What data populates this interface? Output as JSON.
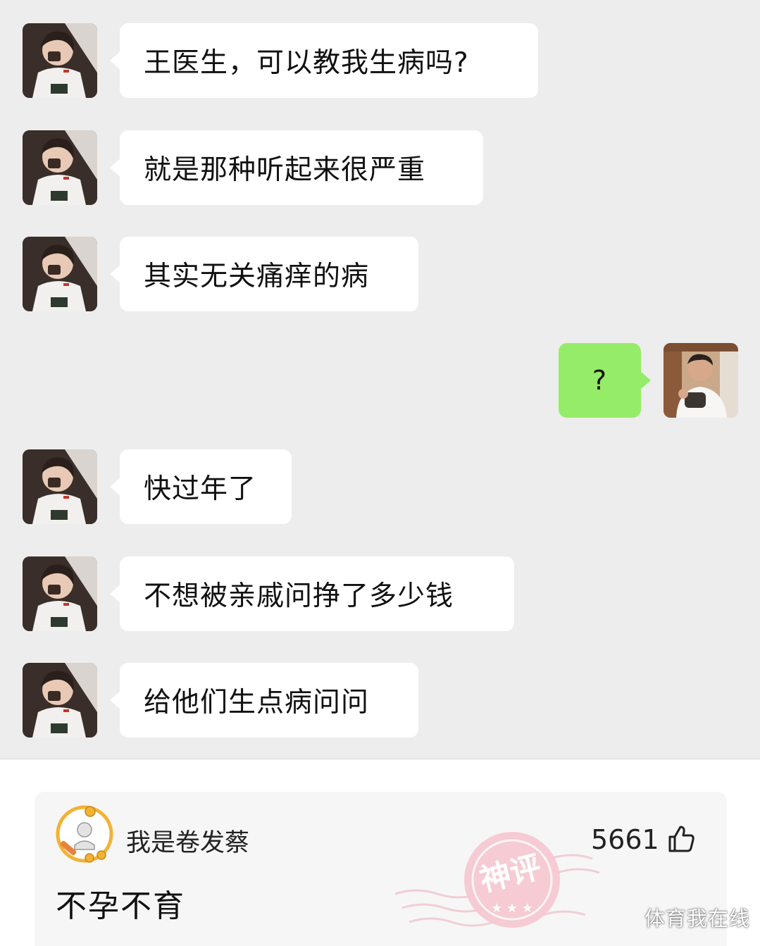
{
  "chat": {
    "messages": [
      {
        "side": "left",
        "text": "王医生，可以教我生病吗?"
      },
      {
        "side": "left",
        "text": "就是那种听起来很严重"
      },
      {
        "side": "left",
        "text": "其实无关痛痒的病"
      },
      {
        "side": "right",
        "text": "?"
      },
      {
        "side": "left",
        "text": "快过年了"
      },
      {
        "side": "left",
        "text": "不想被亲戚问挣了多少钱"
      },
      {
        "side": "left",
        "text": "给他们生点病问问"
      }
    ],
    "colors": {
      "background": "#ededed",
      "incoming_bubble": "#ffffff",
      "outgoing_bubble": "#95ec69"
    }
  },
  "comment": {
    "username": "我是卷发蔡",
    "likes": "5661",
    "text": "不孕不育",
    "badge_text": "神评",
    "like_icon": "thumbs-up-icon"
  },
  "watermark": "体育我在线"
}
